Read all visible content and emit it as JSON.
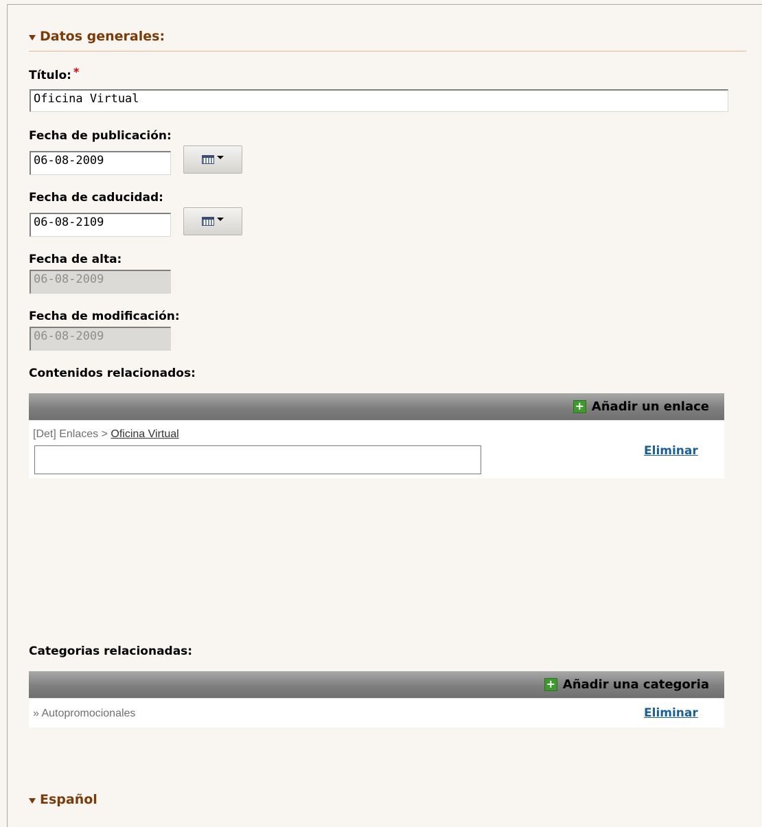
{
  "sections": {
    "general": "Datos generales:",
    "language": "Español"
  },
  "fields": {
    "title": {
      "label": "Título:",
      "required_mark": "*",
      "value": "Oficina Virtual"
    },
    "publication_date": {
      "label": "Fecha de publicación:",
      "value": "06-08-2009"
    },
    "expiry_date": {
      "label": "Fecha de caducidad:",
      "value": "06-08-2109"
    },
    "created_date": {
      "label": "Fecha de alta:",
      "value": "06-08-2009"
    },
    "modified_date": {
      "label": "Fecha de modificación:",
      "value": "06-08-2009"
    }
  },
  "related_contents": {
    "label": "Contenidos relacionados:",
    "add_label": "Añadir un enlace",
    "item": {
      "prefix": "[Det] Enlaces > ",
      "link": "Oficina Virtual",
      "input_value": ""
    },
    "delete_label": "Eliminar"
  },
  "related_categories": {
    "label": "Categorias relacionadas:",
    "add_label": "Añadir una categoria",
    "item": {
      "text": "» Autopromocionales"
    },
    "delete_label": "Eliminar"
  },
  "icons": {
    "section_bullet": "triangle-down-icon",
    "calendar": "calendar-icon",
    "add": "plus-icon"
  },
  "colors": {
    "section_title": "#7a3b08",
    "required": "#cc0000",
    "link": "#1a5f9a",
    "add_icon": "#3f9a2d"
  }
}
